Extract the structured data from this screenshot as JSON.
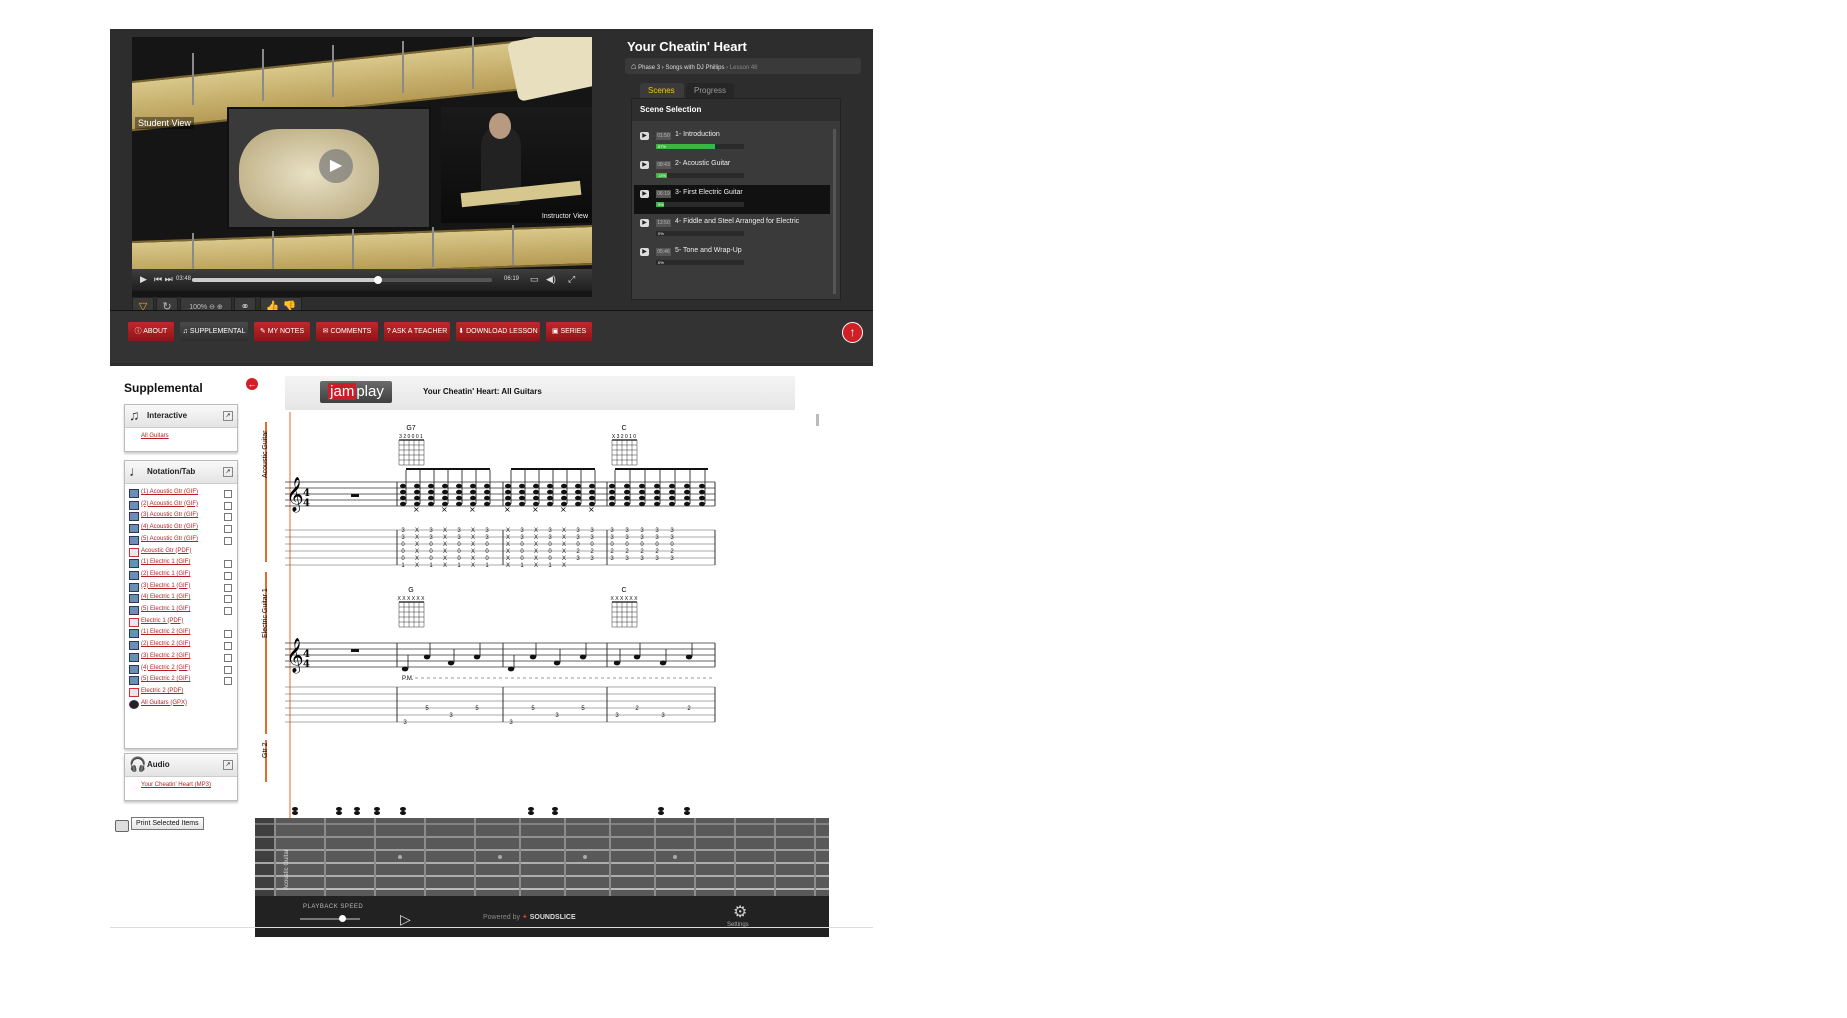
{
  "video": {
    "student_view_label": "Student View",
    "instructor_view_label": "Instructor View",
    "time_current": "03:48",
    "time_total": "06:19",
    "progress_fraction": 0.62,
    "speed_label": "100%"
  },
  "lesson": {
    "title": "Your Cheatin' Heart",
    "breadcrumb": "Phase 3 › Songs with DJ Phillips",
    "breadcrumb_current": "› Lesson 48"
  },
  "tabs": {
    "scenes": "Scenes",
    "progress": "Progress"
  },
  "scene_panel": {
    "heading": "Scene Selection",
    "scenes": [
      {
        "duration": "01:50",
        "name": "1- Introduction",
        "progress": 0.67,
        "pct_label": "67%"
      },
      {
        "duration": "08:43",
        "name": "2- Acoustic Guitar",
        "progress": 0.13,
        "pct_label": "13%"
      },
      {
        "duration": "06:19",
        "name": "3- First Electric Guitar",
        "progress": 0.09,
        "pct_label": "9%"
      },
      {
        "duration": "12:50",
        "name": "4- Fiddle and Steel Arranged for Electric",
        "progress": 0,
        "pct_label": "0%"
      },
      {
        "duration": "05:46",
        "name": "5- Tone and Wrap-Up",
        "progress": 0,
        "pct_label": "0%"
      }
    ]
  },
  "nav": {
    "about": "ABOUT",
    "supplemental": "SUPPLEMENTAL",
    "my_notes": "MY NOTES",
    "comments": "COMMENTS",
    "ask_teacher": "ASK A TEACHER",
    "download_lesson": "DOWNLOAD LESSON",
    "series": "SERIES"
  },
  "supplemental": {
    "title": "Supplemental",
    "interactive": {
      "heading": "Interactive",
      "link": "All Guitars"
    },
    "notation": {
      "heading": "Notation/Tab",
      "items": [
        {
          "label": "(1) Acoustic Gtr (GIF)",
          "type": "gif"
        },
        {
          "label": "(2) Acoustic Gtr (GIF)",
          "type": "gif"
        },
        {
          "label": "(3) Acoustic Gtr (GIF)",
          "type": "gif"
        },
        {
          "label": "(4) Acoustic Gtr (GIF)",
          "type": "gif"
        },
        {
          "label": "(5) Acoustic Gtr (GIF)",
          "type": "gif"
        },
        {
          "label": "Acoustic Gtr (PDF)",
          "type": "pdf"
        },
        {
          "label": "(1) Electric 1 (GIF)",
          "type": "gif"
        },
        {
          "label": "(2) Electric 1 (GIF)",
          "type": "gif"
        },
        {
          "label": "(3) Electric 1 (GIF)",
          "type": "gif"
        },
        {
          "label": "(4) Electric 1 (GIF)",
          "type": "gif"
        },
        {
          "label": "(5) Electric 1 (GIF)",
          "type": "gif"
        },
        {
          "label": "Electric 1 (PDF)",
          "type": "pdf"
        },
        {
          "label": "(1) Electric 2 (GIF)",
          "type": "gif"
        },
        {
          "label": "(2) Electric 2 (GIF)",
          "type": "gif"
        },
        {
          "label": "(3) Electric 2 (GIF)",
          "type": "gif"
        },
        {
          "label": "(4) Electric 2 (GIF)",
          "type": "gif"
        },
        {
          "label": "(5) Electric 2 (GIF)",
          "type": "gif"
        },
        {
          "label": "Electric 2 (PDF)",
          "type": "pdf"
        },
        {
          "label": "All Guitars (GPX)",
          "type": "gpx"
        }
      ]
    },
    "audio": {
      "heading": "Audio",
      "link": "Your Cheatin' Heart (MP3)"
    },
    "print_button": "Print Selected Items"
  },
  "sheet": {
    "logo_jam": "jam",
    "logo_play": "play",
    "title": "Your Cheatin' Heart: All Guitars",
    "staff1": {
      "instrument": "Acoustic Guitar",
      "chords": [
        {
          "name": "G7",
          "fingering": "3 2 0 0 0 1"
        },
        {
          "name": "C",
          "fingering": "X 3 2 0 1 0"
        }
      ],
      "tab_columns": [
        [
          "3",
          "3",
          "0",
          "0",
          "0",
          "1"
        ],
        [
          "X",
          "X",
          "X",
          "X",
          "X",
          "X"
        ],
        [
          "3",
          "3",
          "0",
          "0",
          "0",
          "1"
        ],
        [
          "X",
          "X",
          "X",
          "X",
          "X",
          "X"
        ],
        [
          "3",
          "3",
          "0",
          "0",
          "0",
          "1"
        ],
        [
          "X",
          "X",
          "X",
          "X",
          "X",
          "X"
        ],
        [
          "3",
          "3",
          "0",
          "0",
          "0",
          "1"
        ],
        [
          "X",
          "X",
          "X",
          "X",
          "X",
          "X"
        ],
        [
          "3",
          "3",
          "0",
          "0",
          "0",
          "1"
        ],
        [
          "X",
          "X",
          "X",
          "X",
          "X",
          "X"
        ],
        [
          "3",
          "3",
          "0",
          "0",
          "0",
          "1"
        ],
        [
          "X",
          "X",
          "X",
          "X",
          "X",
          "X"
        ],
        [
          "3",
          "3",
          "0",
          "2",
          "3",
          ""
        ],
        [
          "3",
          "3",
          "0",
          "2",
          "3",
          ""
        ],
        [
          "3",
          "3",
          "0",
          "2",
          "3",
          ""
        ],
        [
          "3",
          "3",
          "0",
          "2",
          "3",
          ""
        ],
        [
          "3",
          "3",
          "0",
          "2",
          "3",
          ""
        ],
        [
          "3",
          "3",
          "0",
          "2",
          "3",
          ""
        ],
        [
          "3",
          "3",
          "0",
          "2",
          "3",
          ""
        ]
      ]
    },
    "staff2": {
      "instrument": "Electric Guitar 1",
      "chords": [
        {
          "name": "G",
          "fingering": "X X X X X X"
        },
        {
          "name": "C",
          "fingering": "X X X X X X"
        }
      ],
      "pm": "P.M.",
      "tab_notes": [
        {
          "string": 6,
          "fret": "3"
        },
        {
          "string": 4,
          "fret": "5"
        },
        {
          "string": 5,
          "fret": "3"
        },
        {
          "string": 4,
          "fret": "5"
        },
        {
          "string": 6,
          "fret": "3"
        },
        {
          "string": 4,
          "fret": "5"
        },
        {
          "string": 5,
          "fret": "3"
        },
        {
          "string": 4,
          "fret": "5"
        },
        {
          "string": 5,
          "fret": "3"
        },
        {
          "string": 4,
          "fret": "2"
        },
        {
          "string": 5,
          "fret": "3"
        },
        {
          "string": 4,
          "fret": "2"
        }
      ]
    },
    "staff3_instrument": "Gtr 2",
    "fretboard_instrument": "Acoustic Guitar"
  },
  "player": {
    "speed_label": "PLAYBACK SPEED",
    "powered_by": "Powered by",
    "brand": "SOUNDSLICE",
    "settings": "Settings"
  },
  "colors": {
    "accent_red": "#c8202a",
    "progress_green": "#3bb54a",
    "scene_active": "#f0c800"
  }
}
